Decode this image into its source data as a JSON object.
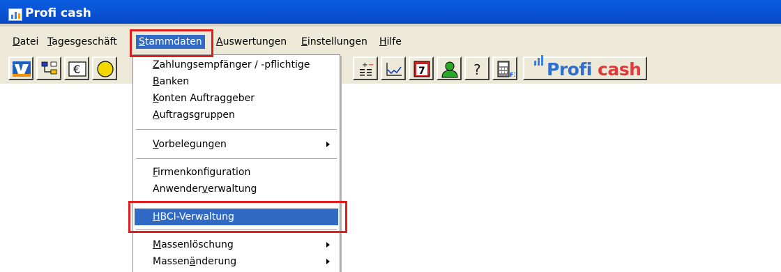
{
  "window": {
    "title": "Profi cash",
    "icon": "profi-cash-app-icon"
  },
  "menubar": {
    "items": [
      {
        "mnemonic": "D",
        "rest": "atei"
      },
      {
        "mnemonic": "T",
        "rest": "agesgeschäft"
      },
      {
        "mnemonic": "S",
        "rest": "tammdaten"
      },
      {
        "mnemonic": "A",
        "rest": "uswertungen"
      },
      {
        "mnemonic": "E",
        "rest": "instellungen"
      },
      {
        "mnemonic": "H",
        "rest": "ilfe"
      }
    ],
    "active": "Stammdaten"
  },
  "toolbar": {
    "buttons": [
      "volksbank-logo-icon",
      "hierarchy-icon",
      "euro-icon",
      "globe-icon",
      "calculator-list-icon",
      "line-chart-icon",
      "calendar-icon",
      "user-icon",
      "help-icon",
      "calculator-f12-icon"
    ],
    "logo": {
      "part1": "Profi",
      "part2": "cash"
    },
    "f12_label": "F12"
  },
  "dropdown": {
    "items": [
      {
        "mnemonic": "Z",
        "rest": "ahlungsempfänger / -pflichtige"
      },
      {
        "mnemonic": "B",
        "rest": "anken"
      },
      {
        "mnemonic": "K",
        "rest": "onten Auftraggeber"
      },
      {
        "mnemonic": "A",
        "rest": "uftragsgruppen"
      },
      {
        "mnemonic": "V",
        "rest": "orbelegungen"
      },
      {
        "mnemonic": "F",
        "rest": "irmenkonfiguration"
      },
      {
        "pre": "Anwender",
        "mnemonic": "v",
        "rest": "erwaltung"
      },
      {
        "mnemonic": "H",
        "rest": "BCI-Verwaltung"
      },
      {
        "mnemonic": "M",
        "rest": "assenlöschung"
      },
      {
        "pre": "Massen",
        "mnemonic": "ä",
        "rest": "nderung"
      }
    ],
    "highlighted": "HBCI-Verwaltung"
  },
  "colors": {
    "titlebar": "#0a55d8",
    "menu_highlight": "#316ac5",
    "annotation_red": "#e21d1d",
    "chrome": "#ece9d8"
  }
}
